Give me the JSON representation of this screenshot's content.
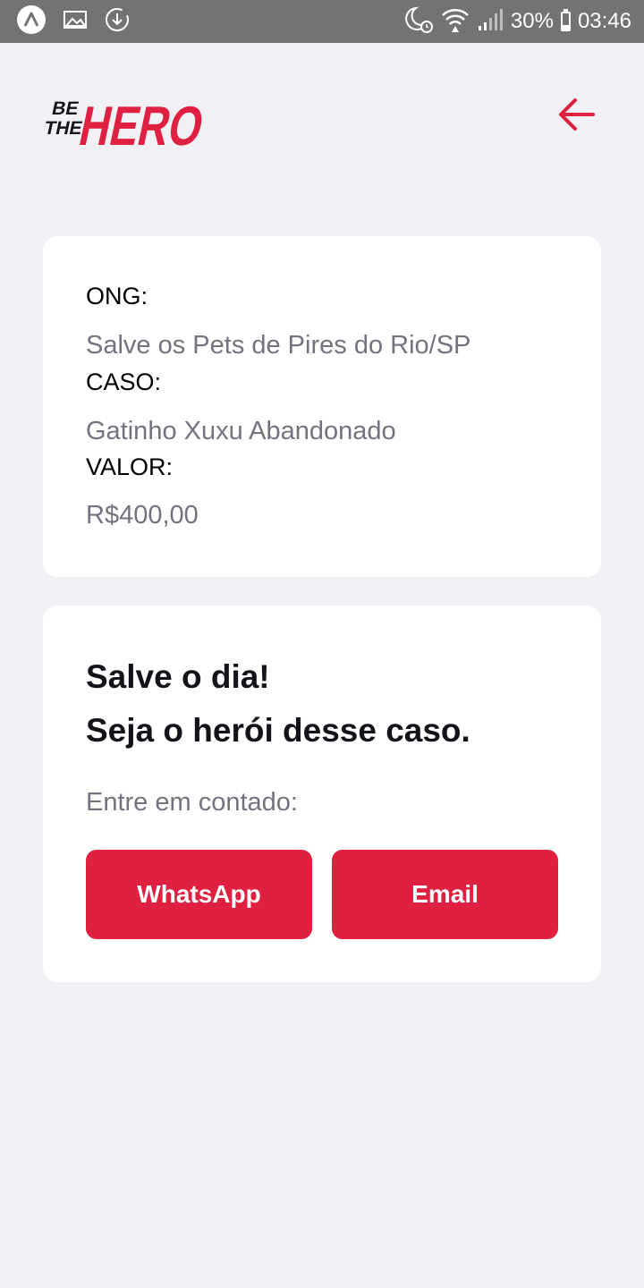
{
  "status_bar": {
    "battery": "30%",
    "time": "03:46",
    "battery_level": 0.3
  },
  "header": {
    "logo_line1": "BE",
    "logo_line2": "THE",
    "logo_word": "HERO",
    "back_icon": "arrow-left-icon"
  },
  "incident": {
    "ong_label": "ONG:",
    "ong_value": "Salve os Pets de Pires do Rio/SP",
    "caso_label": "CASO:",
    "caso_value": "Gatinho Xuxu Abandonado",
    "valor_label": "VALOR:",
    "valor_value": "R$400,00"
  },
  "contact": {
    "title_line1": "Salve o dia!",
    "title_line2": "Seja o herói desse caso.",
    "description": "Entre em contado:",
    "whatsapp_label": "WhatsApp",
    "email_label": "Email"
  },
  "colors": {
    "accent": "#e02041",
    "background": "#f0f0f5",
    "status_bar": "#737373"
  }
}
